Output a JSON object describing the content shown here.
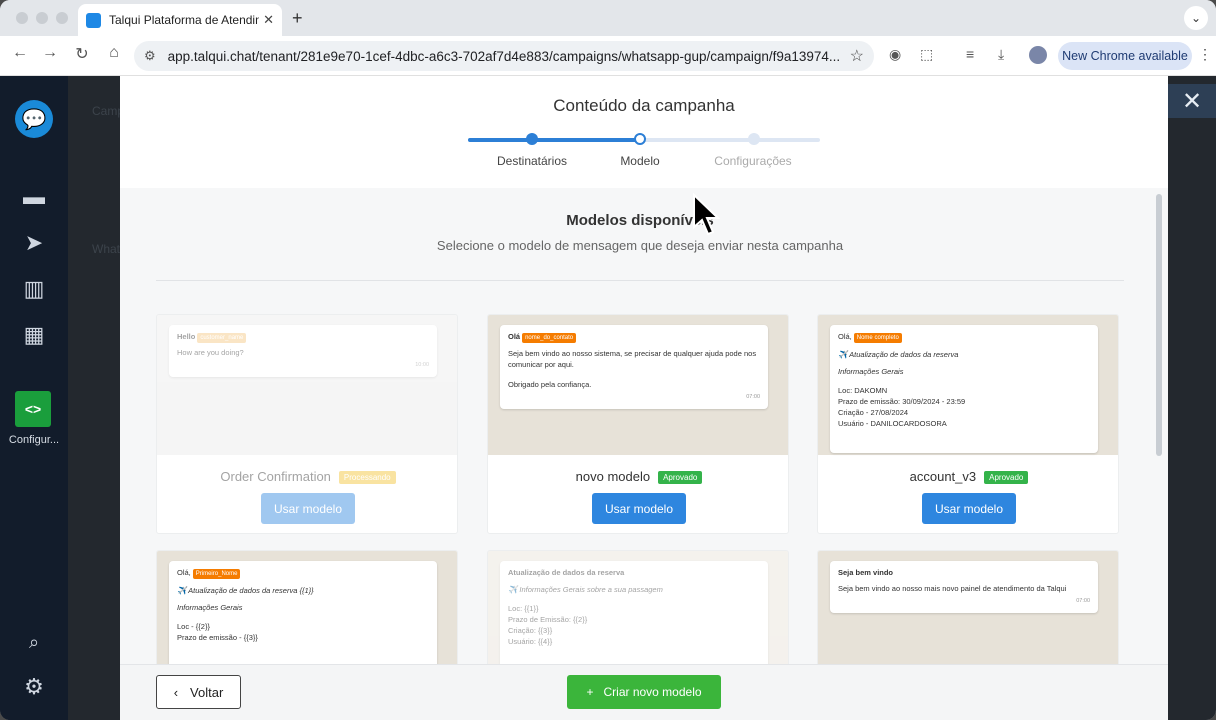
{
  "browser": {
    "tab_title": "Talqui Plataforma de Atendim",
    "tab_close": "✕",
    "new_tab": "+",
    "tab_menu": "⌄",
    "url": "app.talqui.chat/tenant/281e9e70-1cef-4dbc-a6c3-702af7d4e883/campaigns/whatsapp-gup/campaign/f9a13974...",
    "new_chrome": "New Chrome available"
  },
  "sidebar": {
    "config_label": "Configur..."
  },
  "background": {
    "text1": "Camp",
    "text2": "What"
  },
  "modal": {
    "title": "Conteúdo da campanha",
    "steps": [
      {
        "label": "Destinatários"
      },
      {
        "label": "Modelo"
      },
      {
        "label": "Configurações"
      }
    ],
    "progress_fraction": 0.5,
    "section_title": "Modelos disponíveis",
    "section_subtitle": "Selecione o modelo de mensagem que deseja enviar nesta campanha",
    "templates": [
      {
        "name": "Order Confirmation",
        "badge": "Processando",
        "badge_color": "#f2c230",
        "button": "Usar modelo",
        "greeting": "Hello",
        "var": "customer_name",
        "lines": [
          "How are you doing?"
        ],
        "time": "10:00"
      },
      {
        "name": "novo modelo",
        "badge": "Aprovado",
        "badge_color": "#34b34a",
        "button": "Usar modelo",
        "greeting": "Olá",
        "var": "nome_do_contato",
        "lines": [
          "Seja bem vindo ao nosso sistema, se precisar de qualquer ajuda pode nos comunicar por aqui.",
          "Obrigado pela confiança."
        ],
        "time": "07:00"
      },
      {
        "name": "account_v3",
        "badge": "Aprovado",
        "badge_color": "#34b34a",
        "button": "Usar modelo",
        "greeting": "Olá,",
        "var": "Nome completo",
        "lines": [
          "✈️ Atualização de dados da reserva",
          "Informações Gerais",
          "Loc: DAKOMN",
          "Prazo de emissão: 30/09/2024 - 23:59",
          "Criação - 27/08/2024",
          "Usuário - DANILOCARDOSORA"
        ]
      },
      {
        "greeting": "Olá,",
        "var": "Primeiro_Nome",
        "lines": [
          "✈️ Atualização de dados da reserva {{1}}",
          "Informações Gerais",
          "Loc - {{2}}",
          "Prazo de emissão - {{3}}"
        ]
      },
      {
        "greeting": "Atualização de dados da reserva",
        "lines": [
          "✈️ Informações Gerais sobre a sua passagem",
          "Loc: {{1}}",
          "Prazo de Emissão: {{2}}",
          "Criação: {{3}}",
          "Usuário: {{4}}"
        ]
      },
      {
        "greeting": "Seja bem vindo",
        "lines": [
          "Seja bem vindo ao nosso mais novo painel de atendimento da Talqui"
        ],
        "time": "07:00"
      }
    ],
    "back_button": "Voltar",
    "back_icon": "‹",
    "create_button": "Criar novo modelo",
    "create_icon": "+"
  }
}
